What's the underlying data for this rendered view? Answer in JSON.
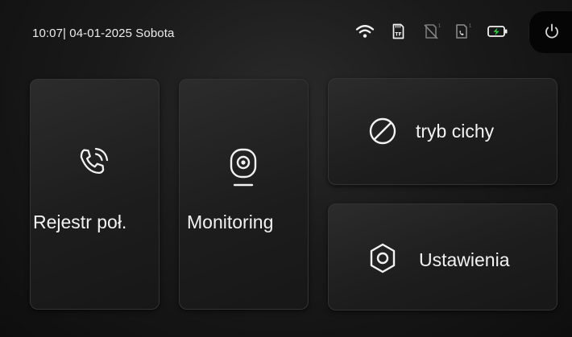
{
  "status_bar": {
    "datetime": "10:07| 04-01-2025 Sobota",
    "icons": [
      "wifi-icon",
      "tf-card-icon",
      "no-signal-icon",
      "sim-icon",
      "battery-charging-icon"
    ],
    "battery_color": "#33d64a",
    "power_icon": "power-icon"
  },
  "tiles": {
    "calls": {
      "label": "Rejestr poł.",
      "icon": "phone-calls-icon"
    },
    "monitoring": {
      "label": "Monitoring",
      "icon": "camera-icon"
    },
    "quiet": {
      "label": "tryb cichy",
      "icon": "do-not-disturb-icon"
    },
    "settings": {
      "label": "Ustawienia",
      "icon": "settings-hexagon-icon"
    }
  }
}
